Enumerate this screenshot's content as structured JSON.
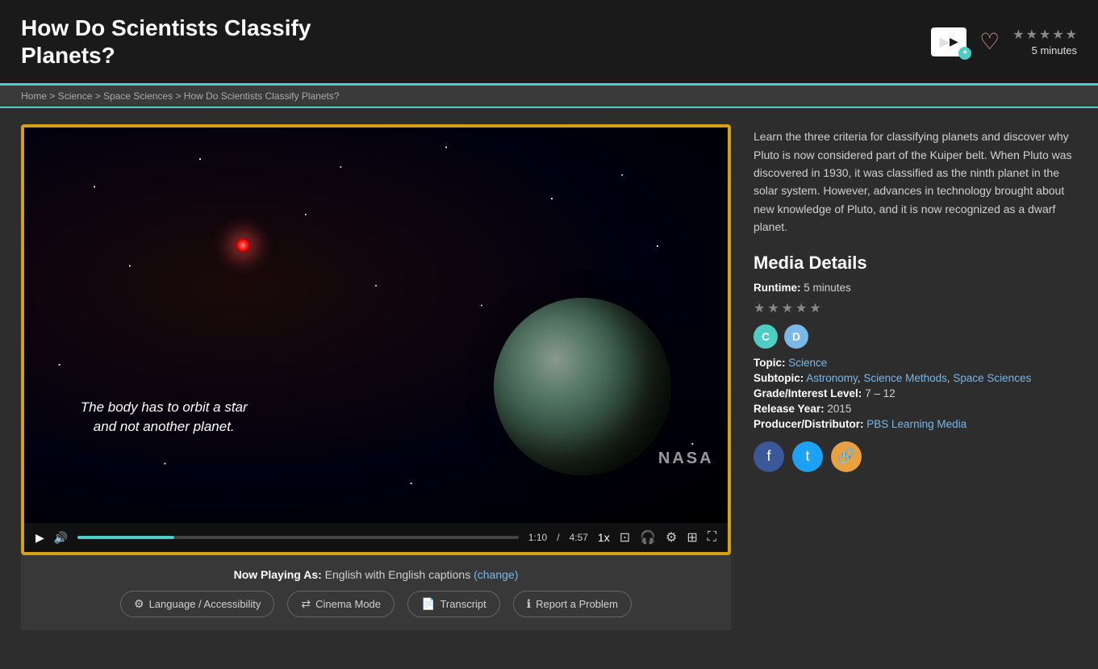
{
  "header": {
    "title_line1": "How Do Scientists Classify",
    "title_line2": "Planets?",
    "duration": "5 minutes",
    "stars": [
      false,
      false,
      false,
      false,
      false
    ],
    "add_icon_label": "add-to-playlist",
    "heart_label": "favorite"
  },
  "breadcrumb": {
    "text": "Home > Science > Space Sciences > How Do Scientists Classify Planets?"
  },
  "video": {
    "subtitle_text": "The body has to orbit a star\nand not another planet.",
    "nasa_watermark": "NASA",
    "current_time": "1:10",
    "total_time": "4:57",
    "speed": "1x",
    "progress_percent": 22
  },
  "description": {
    "text": "Learn the three criteria for classifying planets and discover why Pluto is now considered part of the Kuiper belt. When Pluto was discovered in 1930, it was classified as the ninth planet in the solar system. However, advances in technology brought about new knowledge of Pluto, and it is now recognized as a dwarf planet."
  },
  "media_details": {
    "title": "Media Details",
    "runtime_label": "Runtime:",
    "runtime_value": "5 minutes",
    "stars": [
      false,
      false,
      false,
      false,
      false
    ],
    "badges": [
      {
        "letter": "C",
        "style": "badge-c"
      },
      {
        "letter": "D",
        "style": "badge-d"
      }
    ],
    "topic_label": "Topic:",
    "topic_value": "Science",
    "subtopic_label": "Subtopic:",
    "subtopics": [
      "Astronomy",
      "Science Methods",
      "Space Sciences"
    ],
    "grade_label": "Grade/Interest Level:",
    "grade_value": "7 – 12",
    "release_label": "Release Year:",
    "release_value": "2015",
    "producer_label": "Producer/Distributor:",
    "producer_value": "PBS Learning Media"
  },
  "social": {
    "facebook_label": "f",
    "twitter_label": "t",
    "link_label": "🔗"
  },
  "bottom_bar": {
    "now_playing_label": "Now Playing As:",
    "now_playing_value": "English with English captions",
    "change_label": "(change)",
    "buttons": [
      {
        "label": "Language / Accessibility",
        "icon": "⚙"
      },
      {
        "label": "Cinema Mode",
        "icon": "⇄"
      },
      {
        "label": "Transcript",
        "icon": "📄"
      },
      {
        "label": "Report a Problem",
        "icon": "ℹ"
      }
    ]
  }
}
